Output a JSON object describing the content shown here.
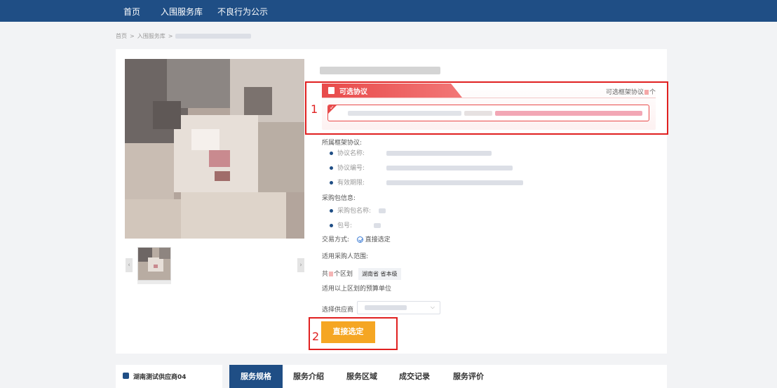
{
  "nav": {
    "items": [
      "首页",
      "入围服务库",
      "不良行为公示"
    ]
  },
  "breadcrumb": {
    "home": "首页",
    "library": "入围服务库",
    "sep": ">"
  },
  "agreement": {
    "tab_label": "可选协议",
    "count_label": "可选框架协议",
    "count_unit": "个"
  },
  "details": {
    "framework_label": "所属框架协议:",
    "agreement_name_label": "协议名称:",
    "agreement_no_label": "协议编号:",
    "validity_label": "有效期限:",
    "package_label": "采购包信息:",
    "package_name_label": "采购包名称:",
    "package_no_label": "包号:",
    "trade_label": "交易方式:",
    "trade_value": "直接选定",
    "scope_label": "适用采购人范围:",
    "scope_prefix": "共",
    "scope_suffix": "个区划",
    "region_tag": "湖南省 省本级",
    "budget_text": "适用以上区划的预算单位",
    "supplier_select_label": "选择供应商",
    "direct_select_button": "直接选定"
  },
  "annotations": {
    "one": "1",
    "two": "2"
  },
  "bottom": {
    "supplier_name": "湖南测试供应商04",
    "tabs": [
      "服务规格",
      "服务介绍",
      "服务区域",
      "成交记录",
      "服务评价"
    ]
  },
  "colors": {
    "nav": "#1f4e85",
    "accent_red": "#e84a4a",
    "button_orange": "#f5a623",
    "annotation": "#e02020"
  }
}
